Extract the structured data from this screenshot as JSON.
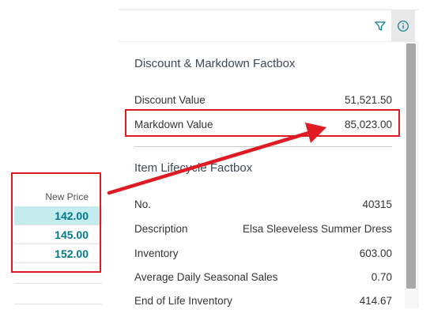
{
  "grid": {
    "column_header": "New Price",
    "rows": [
      "142.00",
      "145.00",
      "152.00"
    ]
  },
  "toolbar": {
    "filter_icon": "filter-icon",
    "info_icon": "info-icon"
  },
  "discount_factbox": {
    "title": "Discount & Markdown Factbox",
    "rows": [
      {
        "label": "Discount Value",
        "value": "51,521.50"
      },
      {
        "label": "Markdown Value",
        "value": "85,023.00"
      }
    ]
  },
  "lifecycle_factbox": {
    "title": "Item Lifecycle Factbox",
    "rows": [
      {
        "label": "No.",
        "value": "40315"
      },
      {
        "label": "Description",
        "value": "Elsa Sleeveless Summer Dress"
      },
      {
        "label": "Inventory",
        "value": "603.00"
      },
      {
        "label": "Average Daily Seasonal Sales",
        "value": "0.70"
      },
      {
        "label": "End of Life Inventory",
        "value": "414.67"
      }
    ]
  },
  "colors": {
    "highlight": "#e01a22",
    "accent": "#00788a",
    "selected_row": "#c4ecef"
  }
}
